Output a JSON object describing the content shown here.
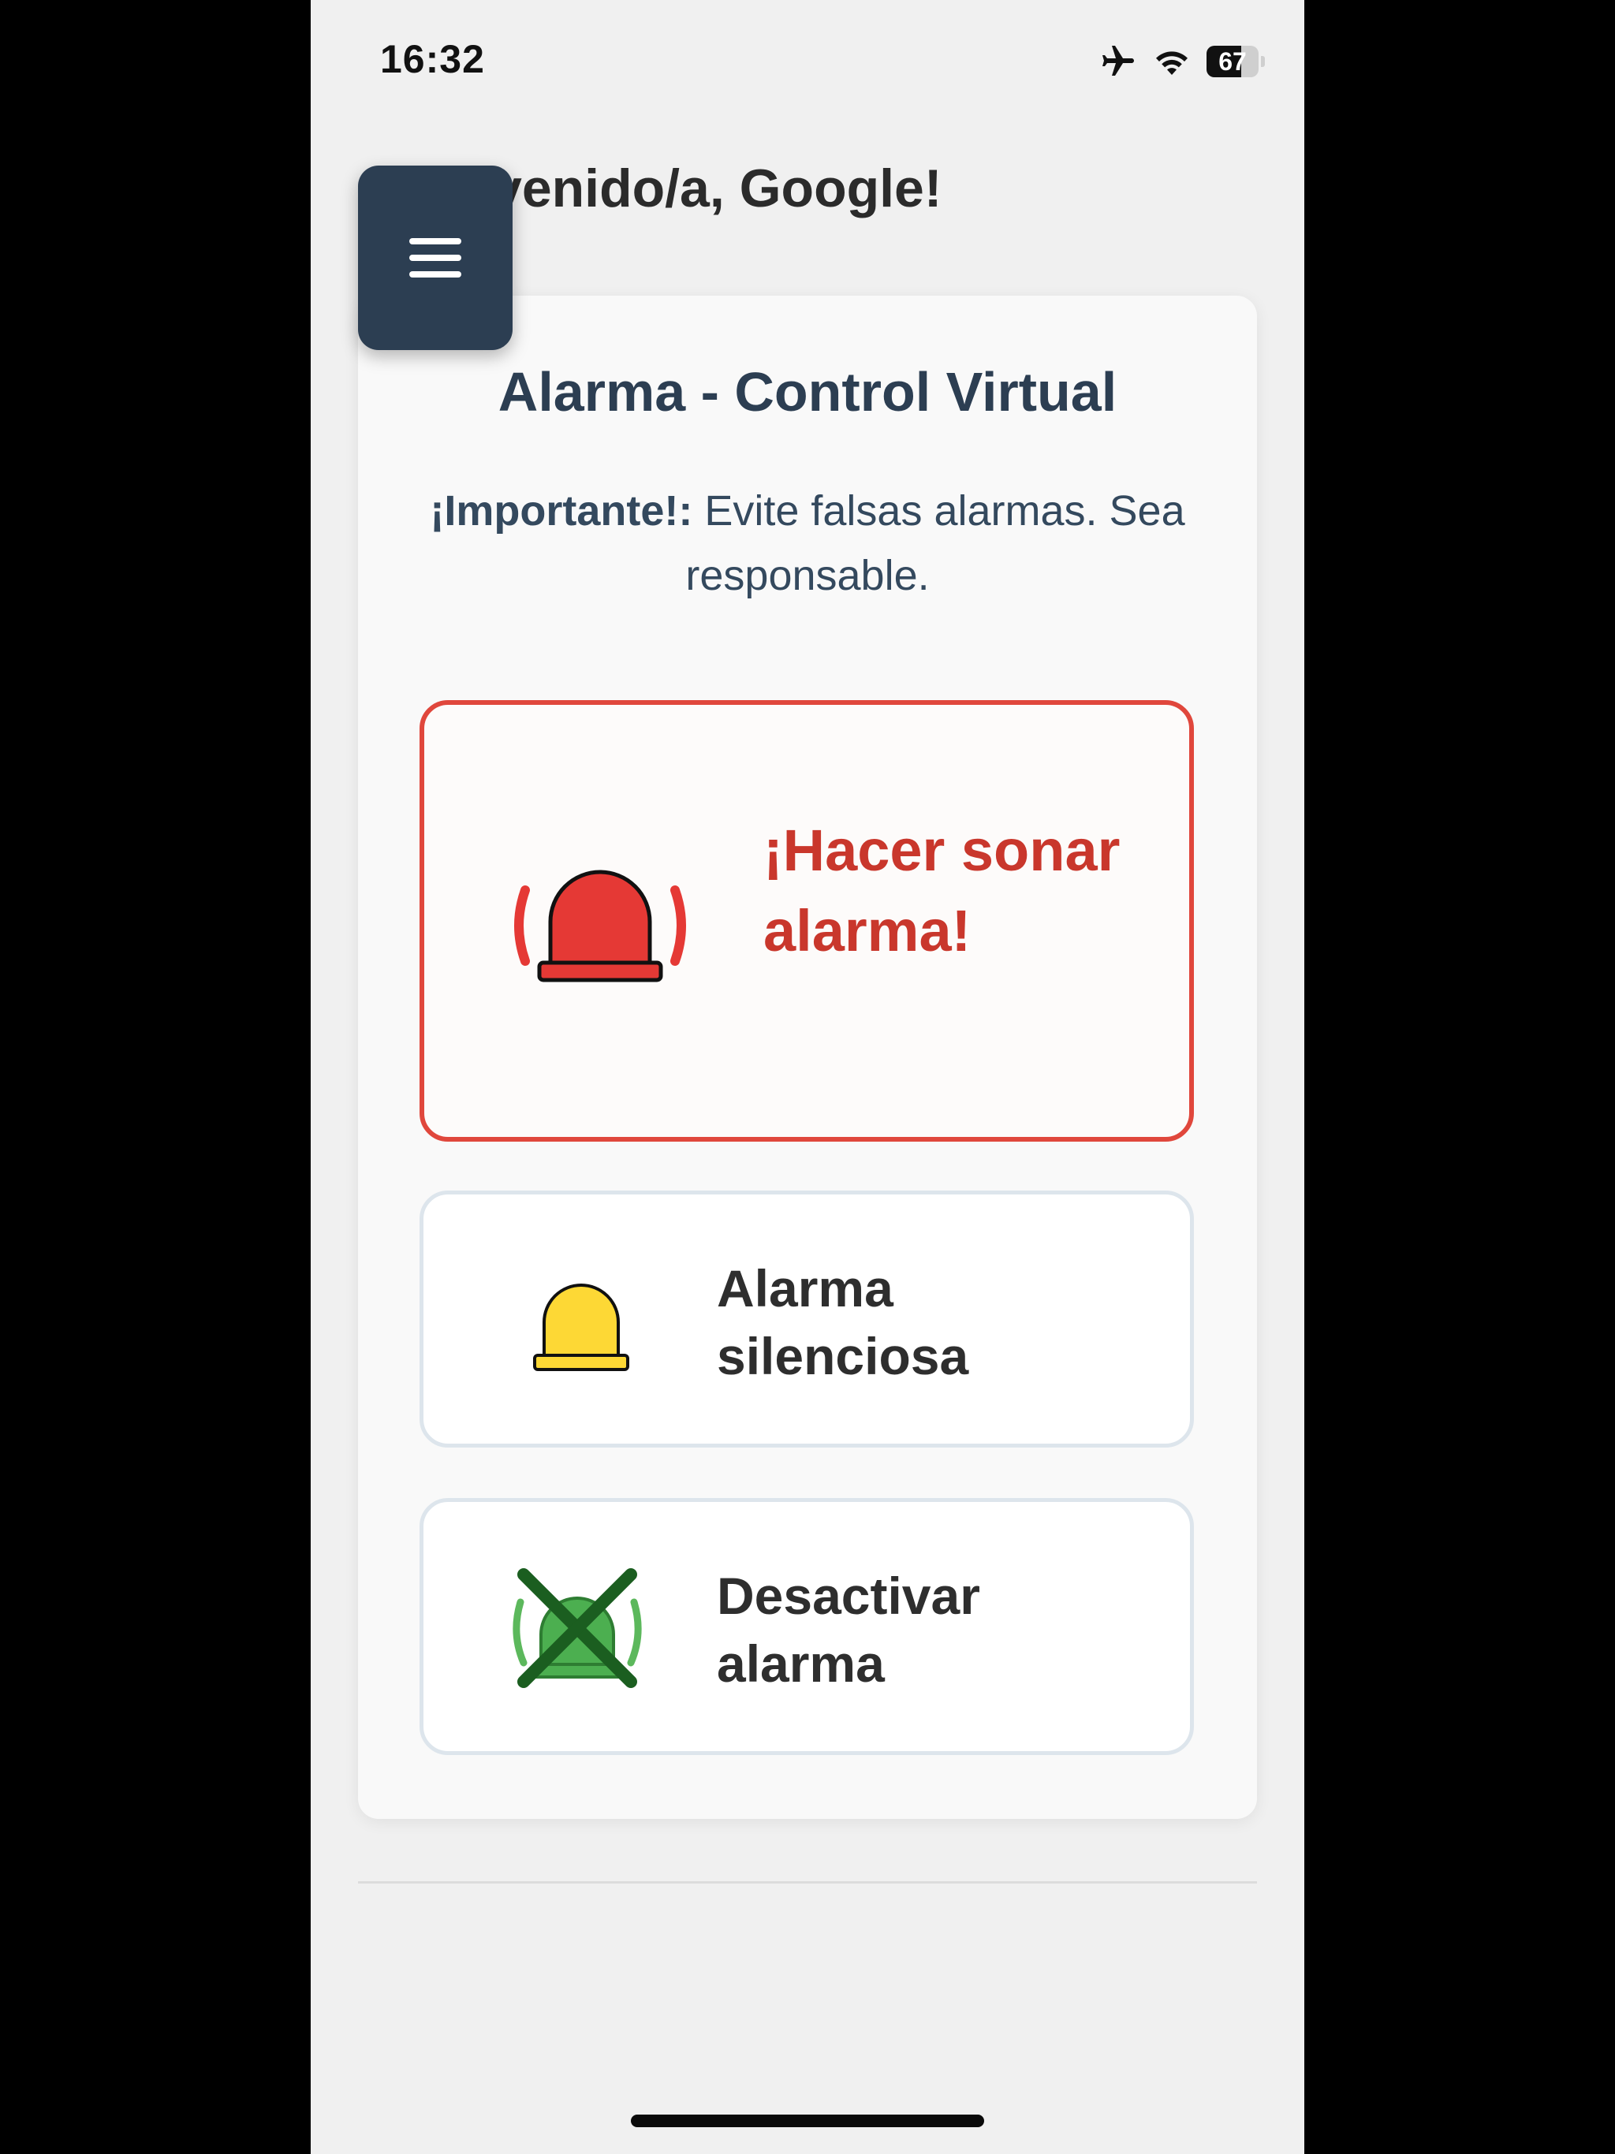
{
  "status_bar": {
    "time": "16:32",
    "battery_level": "67",
    "battery_fraction": 0.67,
    "icons": [
      "airplane-icon",
      "wifi-icon",
      "battery-icon"
    ]
  },
  "header": {
    "welcome": "¡Bienvenido/a, Google!",
    "menu_icon": "hamburger-menu-icon"
  },
  "card": {
    "title": "Alarma - Control Virtual",
    "notice_bold": "¡Importante!:",
    "notice_text": " Evite falsas alarmas. Sea responsable."
  },
  "buttons": [
    {
      "label": "¡Hacer sonar alarma!",
      "icon": "red-siren-ringing-icon",
      "color": "#c9372c"
    },
    {
      "label": "Alarma silenciosa",
      "icon": "yellow-siren-icon",
      "color": "#2e2e2e"
    },
    {
      "label": "Desactivar alarma",
      "icon": "green-siren-crossed-icon",
      "color": "#2e2e2e"
    }
  ],
  "colors": {
    "primary": "#2c3e52",
    "danger": "#e0473c",
    "danger_text": "#c9372c",
    "siren_red": "#e53935",
    "siren_yellow": "#fdd835",
    "siren_green": "#4caf50",
    "cross_green": "#1b5e20"
  }
}
